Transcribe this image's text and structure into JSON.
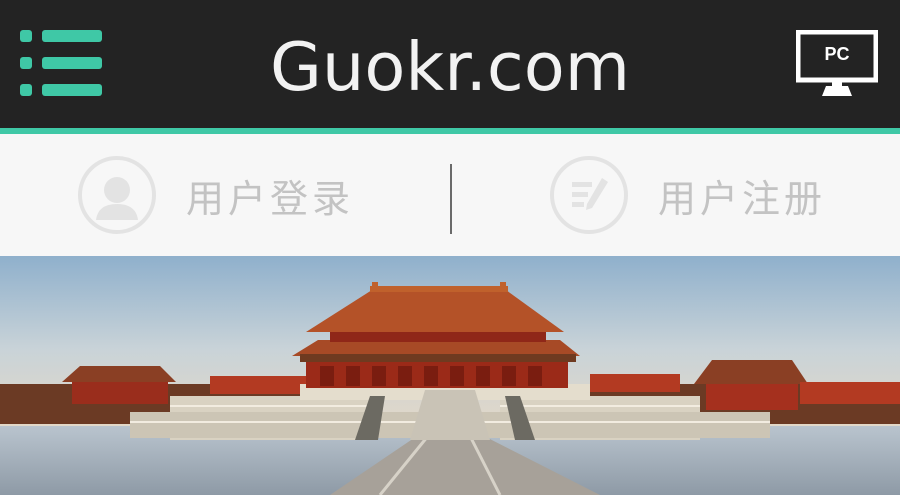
{
  "header": {
    "logo_text": "Guokr.com",
    "menu_icon": "list-menu-icon",
    "pc_label": "PC",
    "pc_icon": "monitor-icon",
    "accent_color": "#3fc8a6",
    "background_color": "#232323"
  },
  "auth": {
    "login_label": "用户登录",
    "login_icon": "user-avatar-icon",
    "register_label": "用户注册",
    "register_icon": "edit-form-icon"
  },
  "hero": {
    "image_subject": "palace-hall-photo"
  }
}
